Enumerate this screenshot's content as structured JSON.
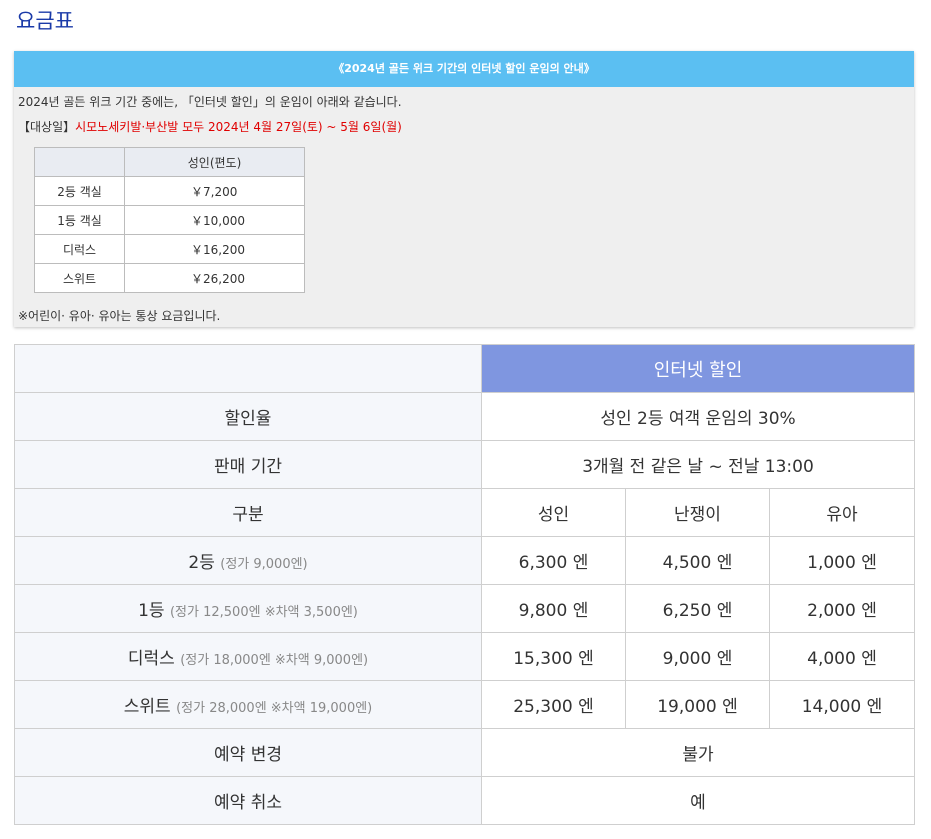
{
  "page_title": "요금표",
  "notice": {
    "header": "《2024년 골든 위크 기간의 인터넷 할인 운임의 안내》",
    "line1": "2024년 골든 위크 기간 중에는, 「인터넷 할인」의 운임이 아래와 같습니다.",
    "line2_label": "【대상일】",
    "line2_value": "시모노세키발·부산발 모두 2024년 4월 27일(토) ~ 5월 6일(월)",
    "table": {
      "header": "성인(편도)",
      "rows": [
        {
          "class": "2등 객실",
          "price": "￥7,200"
        },
        {
          "class": "1등 객실",
          "price": "￥10,000"
        },
        {
          "class": "디럭스",
          "price": "￥16,200"
        },
        {
          "class": "스위트",
          "price": "￥26,200"
        }
      ]
    },
    "note": "※어린이· 유아· 유아는 통상 요금입니다."
  },
  "main": {
    "header": "인터넷 할인",
    "discount_label": "할인율",
    "discount_value": "성인 2등 여객 운임의 30%",
    "period_label": "판매 기간",
    "period_value": "3개월 전 같은 날 ~ 전날 13:00",
    "category_label": "구분",
    "columns": [
      "성인",
      "난쟁이",
      "유아"
    ],
    "rows": [
      {
        "name": "2등",
        "sub": "(정가 9,000엔)",
        "values": [
          "6,300 엔",
          "4,500 엔",
          "1,000 엔"
        ]
      },
      {
        "name": "1등",
        "sub": "(정가 12,500엔 ※차액 3,500엔)",
        "values": [
          "9,800 엔",
          "6,250 엔",
          "2,000 엔"
        ]
      },
      {
        "name": "디럭스",
        "sub": "(정가 18,000엔 ※차액 9,000엔)",
        "values": [
          "15,300 엔",
          "9,000 엔",
          "4,000 엔"
        ]
      },
      {
        "name": "스위트",
        "sub": "(정가 28,000엔 ※차액 19,000엔)",
        "values": [
          "25,300 엔",
          "19,000 엔",
          "14,000 엔"
        ]
      }
    ],
    "change_label": "예약 변경",
    "change_value": "불가",
    "cancel_label": "예약 취소",
    "cancel_value": "예"
  }
}
